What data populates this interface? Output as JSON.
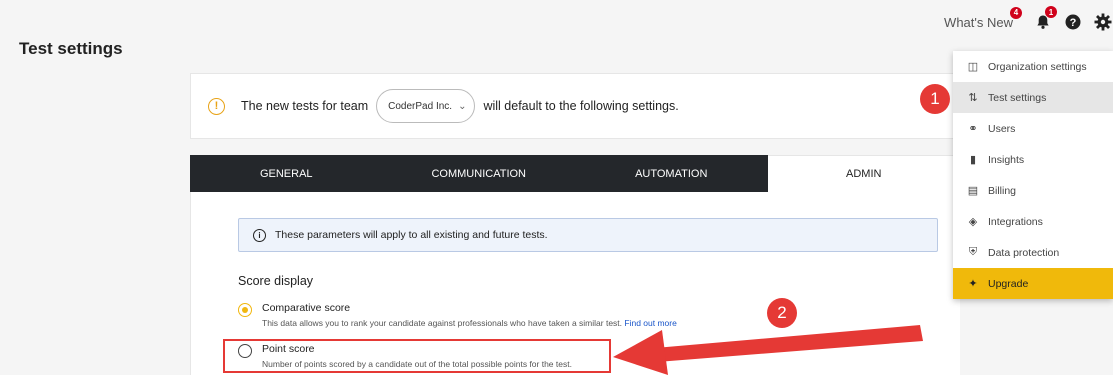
{
  "page": {
    "title": "Test settings"
  },
  "topbar": {
    "whats_new_label": "What's New",
    "whats_new_badge": "4",
    "bell_badge": "1",
    "help_icon": "help-icon",
    "gear_icon": "gear-icon"
  },
  "banner": {
    "text_before": "The new tests for team",
    "team_value": "CoderPad Inc.",
    "text_after": "will default to the following settings."
  },
  "tabs": [
    {
      "label": "GENERAL"
    },
    {
      "label": "COMMUNICATION"
    },
    {
      "label": "AUTOMATION"
    },
    {
      "label": "ADMIN"
    }
  ],
  "admin": {
    "info_text": "These parameters will apply to all existing and future tests.",
    "score_display_title": "Score display",
    "options": [
      {
        "label": "Comparative score",
        "description": "This data allows you to rank your candidate against professionals who have taken a similar test.",
        "link": "Find out more",
        "checked": true
      },
      {
        "label": "Point score",
        "description": "Number of points scored by a candidate out of the total possible points for the test.",
        "checked": false
      }
    ]
  },
  "menu": {
    "items": [
      {
        "label": "Organization settings",
        "icon": "organization-icon"
      },
      {
        "label": "Test settings",
        "icon": "sliders-icon"
      },
      {
        "label": "Users",
        "icon": "users-icon"
      },
      {
        "label": "Insights",
        "icon": "insights-icon"
      },
      {
        "label": "Billing",
        "icon": "billing-icon"
      },
      {
        "label": "Integrations",
        "icon": "puzzle-icon"
      },
      {
        "label": "Data protection",
        "icon": "shield-icon"
      },
      {
        "label": "Upgrade",
        "icon": "sparkle-icon"
      }
    ]
  },
  "annotations": {
    "step1": "1",
    "step2": "2"
  },
  "colors": {
    "accent": "#f0b90b",
    "tab_dark": "#24272b",
    "annotation_red": "#e53935"
  }
}
